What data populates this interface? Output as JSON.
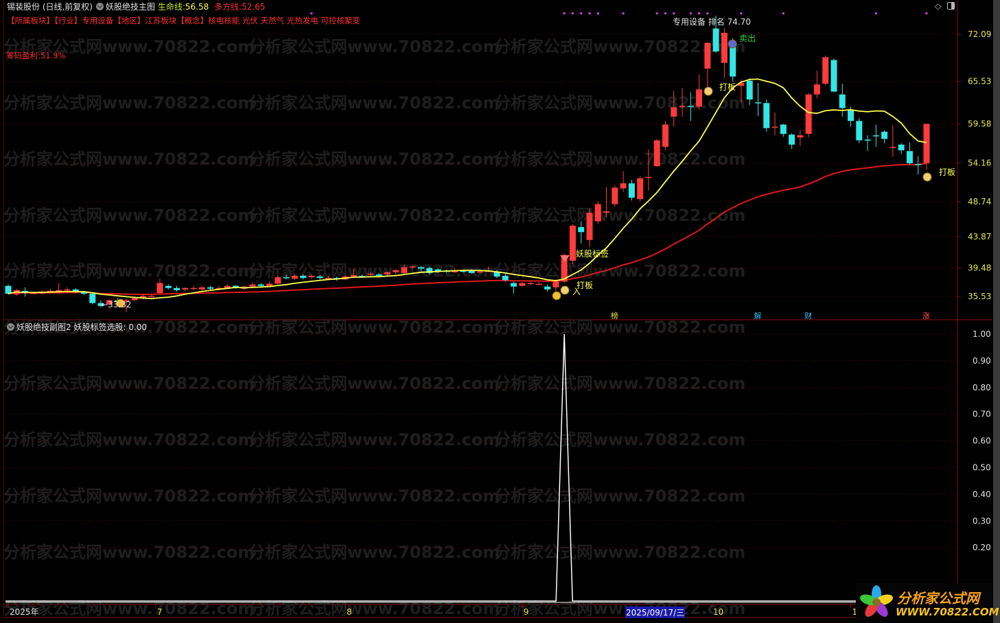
{
  "header": {
    "stock": "锡装股份 (日线,前复权)",
    "indicator": "妖股绝技主图",
    "life_line_label": "生命线:",
    "life_line_value": "56.58",
    "bull_line_label": "多方线:",
    "bull_line_value": "52.65",
    "sector_line": "【所属板块】【行业】专用设备【地区】江苏板块【概念】核电核能 光伏 天然气 光热发电 可控核聚变",
    "chip_profit": "筹码盈利:51.9%"
  },
  "sub_header": {
    "indicator": "妖股绝技副图2",
    "label": "妖股标签选股:",
    "value": "0.00"
  },
  "watermark": "分析家公式网www.70822.com",
  "colors": {
    "up": "#ff3b3b",
    "down": "#32e6e6",
    "life": "#ffff50",
    "bull": "#e01818",
    "grid": "#5a0c0c",
    "axis": "#e6e64a"
  },
  "annotations": {
    "rank": "专用设备 排名 74.70",
    "sell": "卖出",
    "daban1": "打板",
    "daban2": "打板",
    "daban3": "打板",
    "yaogu": "妖股标签",
    "buy": "入",
    "low": "←33.32",
    "badges": [
      "榜",
      "解",
      "财",
      "涨"
    ]
  },
  "chart_data": {
    "type": "candlestick",
    "ohlc_note": "[open, close, high, low]",
    "candles": [
      [
        37.0,
        35.9,
        37.2,
        35.8
      ],
      [
        35.8,
        36.4,
        36.6,
        35.6
      ],
      [
        36.3,
        36.0,
        36.8,
        35.5
      ],
      [
        36.0,
        36.0,
        36.2,
        35.9
      ],
      [
        35.9,
        36.2,
        36.4,
        35.8
      ],
      [
        36.1,
        36.3,
        36.6,
        36.0
      ],
      [
        36.2,
        36.4,
        37.4,
        36.0
      ],
      [
        36.4,
        36.5,
        36.8,
        36.2
      ],
      [
        36.5,
        36.2,
        36.7,
        36.0
      ],
      [
        36.2,
        35.9,
        36.3,
        35.7
      ],
      [
        35.9,
        34.6,
        36.0,
        34.4
      ],
      [
        34.6,
        34.2,
        35.0,
        34.0
      ],
      [
        34.4,
        35.0,
        35.1,
        34.3
      ],
      [
        35.0,
        34.8,
        35.3,
        34.4
      ],
      [
        34.8,
        35.0,
        35.2,
        33.32
      ],
      [
        35.0,
        35.3,
        35.6,
        34.9
      ],
      [
        35.3,
        35.6,
        35.8,
        35.1
      ],
      [
        35.6,
        35.6,
        35.8,
        35.4
      ],
      [
        36.0,
        37.4,
        38.0,
        35.9
      ],
      [
        37.0,
        36.7,
        37.2,
        36.5
      ],
      [
        36.7,
        36.4,
        37.0,
        36.2
      ],
      [
        36.5,
        36.7,
        36.8,
        36.3
      ],
      [
        36.7,
        36.7,
        37.0,
        36.4
      ],
      [
        36.5,
        36.8,
        36.9,
        36.3
      ],
      [
        36.8,
        36.6,
        37.0,
        36.4
      ],
      [
        36.6,
        36.7,
        37.0,
        36.4
      ],
      [
        36.6,
        37.0,
        37.2,
        36.5
      ],
      [
        37.0,
        36.8,
        37.1,
        36.6
      ],
      [
        36.6,
        36.9,
        37.0,
        36.4
      ],
      [
        36.9,
        37.2,
        37.5,
        36.8
      ],
      [
        37.2,
        37.0,
        37.4,
        36.8
      ],
      [
        37.0,
        37.3,
        37.6,
        36.9
      ],
      [
        37.3,
        38.2,
        38.4,
        37.2
      ],
      [
        38.2,
        38.1,
        38.6,
        37.9
      ],
      [
        38.0,
        38.4,
        38.6,
        37.8
      ],
      [
        38.4,
        38.1,
        38.6,
        37.9
      ],
      [
        38.2,
        38.4,
        38.6,
        38.0
      ],
      [
        38.3,
        38.1,
        38.5,
        37.9
      ],
      [
        38.0,
        38.1,
        38.4,
        37.8
      ],
      [
        38.1,
        37.9,
        38.3,
        37.7
      ],
      [
        37.9,
        38.3,
        38.5,
        37.8
      ],
      [
        38.3,
        38.5,
        39.4,
        38.2
      ],
      [
        38.4,
        38.3,
        38.6,
        38.1
      ],
      [
        38.6,
        38.7,
        38.9,
        38.4
      ],
      [
        38.6,
        38.4,
        38.8,
        38.2
      ],
      [
        38.6,
        38.9,
        39.0,
        38.4
      ],
      [
        38.9,
        39.2,
        39.3,
        38.7
      ],
      [
        38.8,
        39.6,
        40.0,
        38.7
      ],
      [
        39.6,
        39.7,
        39.9,
        39.4
      ],
      [
        39.6,
        39.4,
        39.8,
        39.0
      ],
      [
        39.5,
        38.8,
        39.6,
        38.6
      ],
      [
        39.3,
        39.0,
        39.5,
        38.8
      ],
      [
        39.1,
        39.0,
        39.3,
        38.8
      ],
      [
        38.9,
        39.1,
        39.5,
        38.8
      ],
      [
        39.1,
        39.0,
        39.2,
        38.9
      ],
      [
        39.2,
        38.8,
        39.4,
        38.7
      ],
      [
        39.0,
        39.0,
        39.2,
        38.8
      ],
      [
        39.0,
        39.1,
        39.7,
        38.9
      ],
      [
        39.0,
        38.3,
        39.2,
        38.1
      ],
      [
        38.4,
        37.8,
        38.9,
        37.6
      ],
      [
        37.4,
        36.9,
        37.6,
        35.9
      ],
      [
        37.0,
        37.4,
        37.5,
        36.9
      ],
      [
        37.3,
        37.4,
        37.6,
        37.1
      ],
      [
        37.3,
        37.3,
        37.5,
        37.1
      ],
      [
        36.9,
        36.5,
        37.2,
        36.2
      ],
      [
        36.8,
        37.6,
        37.9,
        36.3
      ],
      [
        37.6,
        41.3,
        41.5,
        37.4
      ],
      [
        40.5,
        45.4,
        45.6,
        40.0
      ],
      [
        45.2,
        44.5,
        46.0,
        42.9
      ],
      [
        43.4,
        47.2,
        47.8,
        42.4
      ],
      [
        46.0,
        48.4,
        48.8,
        45.6
      ],
      [
        47.2,
        47.4,
        50.8,
        46.6
      ],
      [
        48.4,
        50.7,
        51.0,
        48.0
      ],
      [
        50.6,
        51.3,
        53.0,
        50.1
      ],
      [
        51.3,
        49.3,
        51.8,
        48.9
      ],
      [
        49.1,
        52.0,
        52.3,
        48.8
      ],
      [
        52.1,
        52.2,
        56.0,
        50.3
      ],
      [
        53.7,
        57.3,
        57.5,
        53.6
      ],
      [
        56.4,
        59.5,
        60.0,
        56.0
      ],
      [
        60.6,
        61.9,
        64.2,
        59.2
      ],
      [
        62.0,
        62.1,
        64.6,
        60.6
      ],
      [
        62.1,
        62.0,
        64.0,
        60.0
      ],
      [
        62.0,
        64.4,
        66.5,
        61.6
      ],
      [
        67.3,
        70.9,
        71.0,
        64.0
      ],
      [
        72.9,
        69.7,
        74.7,
        69.5
      ],
      [
        68.1,
        72.3,
        73.0,
        66.0
      ],
      [
        71.1,
        66.2,
        71.5,
        65.5
      ],
      [
        64.9,
        65.3,
        65.8,
        62.5
      ],
      [
        65.6,
        63.0,
        66.0,
        62.2
      ],
      [
        62.6,
        62.5,
        65.3,
        60.7
      ],
      [
        62.5,
        59.0,
        63.0,
        58.5
      ],
      [
        59.2,
        59.2,
        61.2,
        58.0
      ],
      [
        59.5,
        58.2,
        59.6,
        57.8
      ],
      [
        58.1,
        56.7,
        58.3,
        56.1
      ],
      [
        57.7,
        58.0,
        58.7,
        56.5
      ],
      [
        58.2,
        63.7,
        63.9,
        57.7
      ],
      [
        63.7,
        65.1,
        67.0,
        63.2
      ],
      [
        65.2,
        68.9,
        69.1,
        65.0
      ],
      [
        68.5,
        64.1,
        68.7,
        64.0
      ],
      [
        63.7,
        61.8,
        65.2,
        60.6
      ],
      [
        61.6,
        60.0,
        62.0,
        59.2
      ],
      [
        60.0,
        57.3,
        60.4,
        56.9
      ],
      [
        57.4,
        57.3,
        58.0,
        55.8
      ],
      [
        58.0,
        57.9,
        59.5,
        56.4
      ],
      [
        58.5,
        57.5,
        58.7,
        56.9
      ],
      [
        56.4,
        56.4,
        59.4,
        55.0
      ],
      [
        56.7,
        55.9,
        56.9,
        55.4
      ],
      [
        55.8,
        54.1,
        57.0,
        53.9
      ],
      [
        54.0,
        53.9,
        55.1,
        52.5
      ],
      [
        54.1,
        59.6,
        59.6,
        53.2
      ]
    ],
    "price_range": [
      35.53,
      72.09
    ],
    "price_ticks": [
      "72.09",
      "65.53",
      "59.58",
      "54.16",
      "48.74",
      "43.87",
      "39.48",
      "35.53"
    ],
    "signal_series": {
      "name": "妖股标签选股",
      "spike_index": 66,
      "spike_value": 1.0,
      "base_value": 0.0
    },
    "signal_range": [
      0,
      1.0
    ],
    "signal_ticks": [
      "1.00",
      "0.90",
      "0.80",
      "0.70",
      "0.60",
      "0.50",
      "0.40",
      "0.30",
      "0.20"
    ],
    "x_labels": [
      {
        "i": 0,
        "text": "2025年"
      },
      {
        "i": 17.5,
        "text": "7"
      },
      {
        "i": 40,
        "text": "8"
      },
      {
        "i": 61,
        "text": "9"
      },
      {
        "i": 83.5,
        "text": "10"
      },
      {
        "i": 100,
        "text": "1"
      }
    ],
    "cursor_date": "2025/09/17/三",
    "top_markers": [
      36,
      66,
      67,
      68,
      69,
      70,
      73,
      77,
      78,
      79,
      81,
      82,
      83,
      87,
      92,
      103,
      109
    ],
    "badge_indices": [
      72,
      89,
      95,
      109
    ]
  },
  "logo": {
    "line1": "分析家公式网",
    "line2": "WWW.70822.COM"
  }
}
